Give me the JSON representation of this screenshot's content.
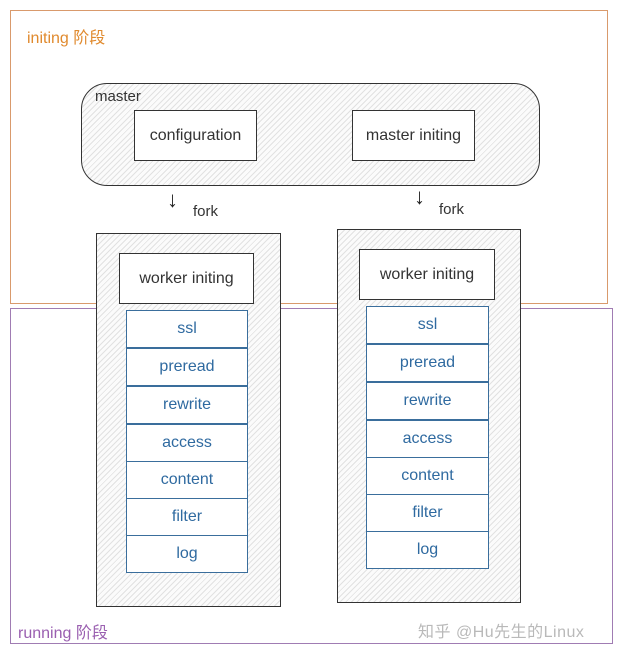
{
  "stages": {
    "initing": {
      "label": "initing 阶段",
      "color": "#e08a2e"
    },
    "running": {
      "label": "running 阶段",
      "color": "#9a5fb0"
    }
  },
  "master": {
    "label": "master",
    "children": [
      "configuration",
      "master initing"
    ]
  },
  "edges": [
    {
      "from": "master",
      "to": "worker-1",
      "label": "fork"
    },
    {
      "from": "master",
      "to": "worker-2",
      "label": "fork"
    }
  ],
  "workers": [
    {
      "init_label": "worker initing",
      "phases": [
        "ssl",
        "preread",
        "rewrite",
        "access",
        "content",
        "filter",
        "log"
      ]
    },
    {
      "init_label": "worker initing",
      "phases": [
        "ssl",
        "preread",
        "rewrite",
        "access",
        "content",
        "filter",
        "log"
      ]
    }
  ],
  "watermark": "知乎 @Hu先生的Linux"
}
